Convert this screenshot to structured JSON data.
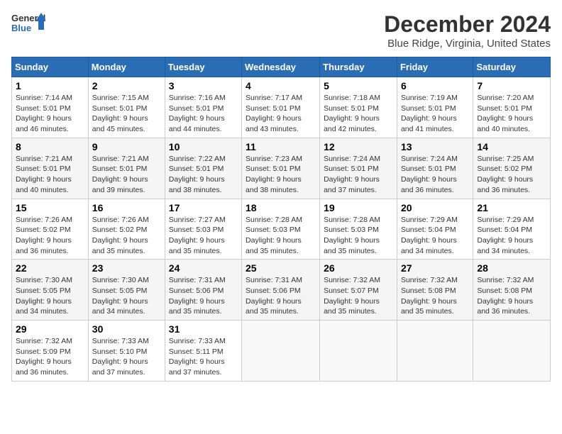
{
  "logo": {
    "line1": "General",
    "line2": "Blue"
  },
  "title": "December 2024",
  "subtitle": "Blue Ridge, Virginia, United States",
  "days_of_week": [
    "Sunday",
    "Monday",
    "Tuesday",
    "Wednesday",
    "Thursday",
    "Friday",
    "Saturday"
  ],
  "weeks": [
    [
      {
        "day": "1",
        "sunrise": "7:14 AM",
        "sunset": "5:01 PM",
        "daylight": "9 hours and 46 minutes."
      },
      {
        "day": "2",
        "sunrise": "7:15 AM",
        "sunset": "5:01 PM",
        "daylight": "9 hours and 45 minutes."
      },
      {
        "day": "3",
        "sunrise": "7:16 AM",
        "sunset": "5:01 PM",
        "daylight": "9 hours and 44 minutes."
      },
      {
        "day": "4",
        "sunrise": "7:17 AM",
        "sunset": "5:01 PM",
        "daylight": "9 hours and 43 minutes."
      },
      {
        "day": "5",
        "sunrise": "7:18 AM",
        "sunset": "5:01 PM",
        "daylight": "9 hours and 42 minutes."
      },
      {
        "day": "6",
        "sunrise": "7:19 AM",
        "sunset": "5:01 PM",
        "daylight": "9 hours and 41 minutes."
      },
      {
        "day": "7",
        "sunrise": "7:20 AM",
        "sunset": "5:01 PM",
        "daylight": "9 hours and 40 minutes."
      }
    ],
    [
      {
        "day": "8",
        "sunrise": "7:21 AM",
        "sunset": "5:01 PM",
        "daylight": "9 hours and 40 minutes."
      },
      {
        "day": "9",
        "sunrise": "7:21 AM",
        "sunset": "5:01 PM",
        "daylight": "9 hours and 39 minutes."
      },
      {
        "day": "10",
        "sunrise": "7:22 AM",
        "sunset": "5:01 PM",
        "daylight": "9 hours and 38 minutes."
      },
      {
        "day": "11",
        "sunrise": "7:23 AM",
        "sunset": "5:01 PM",
        "daylight": "9 hours and 38 minutes."
      },
      {
        "day": "12",
        "sunrise": "7:24 AM",
        "sunset": "5:01 PM",
        "daylight": "9 hours and 37 minutes."
      },
      {
        "day": "13",
        "sunrise": "7:24 AM",
        "sunset": "5:01 PM",
        "daylight": "9 hours and 36 minutes."
      },
      {
        "day": "14",
        "sunrise": "7:25 AM",
        "sunset": "5:02 PM",
        "daylight": "9 hours and 36 minutes."
      }
    ],
    [
      {
        "day": "15",
        "sunrise": "7:26 AM",
        "sunset": "5:02 PM",
        "daylight": "9 hours and 36 minutes."
      },
      {
        "day": "16",
        "sunrise": "7:26 AM",
        "sunset": "5:02 PM",
        "daylight": "9 hours and 35 minutes."
      },
      {
        "day": "17",
        "sunrise": "7:27 AM",
        "sunset": "5:03 PM",
        "daylight": "9 hours and 35 minutes."
      },
      {
        "day": "18",
        "sunrise": "7:28 AM",
        "sunset": "5:03 PM",
        "daylight": "9 hours and 35 minutes."
      },
      {
        "day": "19",
        "sunrise": "7:28 AM",
        "sunset": "5:03 PM",
        "daylight": "9 hours and 35 minutes."
      },
      {
        "day": "20",
        "sunrise": "7:29 AM",
        "sunset": "5:04 PM",
        "daylight": "9 hours and 34 minutes."
      },
      {
        "day": "21",
        "sunrise": "7:29 AM",
        "sunset": "5:04 PM",
        "daylight": "9 hours and 34 minutes."
      }
    ],
    [
      {
        "day": "22",
        "sunrise": "7:30 AM",
        "sunset": "5:05 PM",
        "daylight": "9 hours and 34 minutes."
      },
      {
        "day": "23",
        "sunrise": "7:30 AM",
        "sunset": "5:05 PM",
        "daylight": "9 hours and 34 minutes."
      },
      {
        "day": "24",
        "sunrise": "7:31 AM",
        "sunset": "5:06 PM",
        "daylight": "9 hours and 35 minutes."
      },
      {
        "day": "25",
        "sunrise": "7:31 AM",
        "sunset": "5:06 PM",
        "daylight": "9 hours and 35 minutes."
      },
      {
        "day": "26",
        "sunrise": "7:32 AM",
        "sunset": "5:07 PM",
        "daylight": "9 hours and 35 minutes."
      },
      {
        "day": "27",
        "sunrise": "7:32 AM",
        "sunset": "5:08 PM",
        "daylight": "9 hours and 35 minutes."
      },
      {
        "day": "28",
        "sunrise": "7:32 AM",
        "sunset": "5:08 PM",
        "daylight": "9 hours and 36 minutes."
      }
    ],
    [
      {
        "day": "29",
        "sunrise": "7:32 AM",
        "sunset": "5:09 PM",
        "daylight": "9 hours and 36 minutes."
      },
      {
        "day": "30",
        "sunrise": "7:33 AM",
        "sunset": "5:10 PM",
        "daylight": "9 hours and 37 minutes."
      },
      {
        "day": "31",
        "sunrise": "7:33 AM",
        "sunset": "5:11 PM",
        "daylight": "9 hours and 37 minutes."
      },
      null,
      null,
      null,
      null
    ]
  ],
  "labels": {
    "sunrise": "Sunrise:",
    "sunset": "Sunset:",
    "daylight": "Daylight:"
  }
}
